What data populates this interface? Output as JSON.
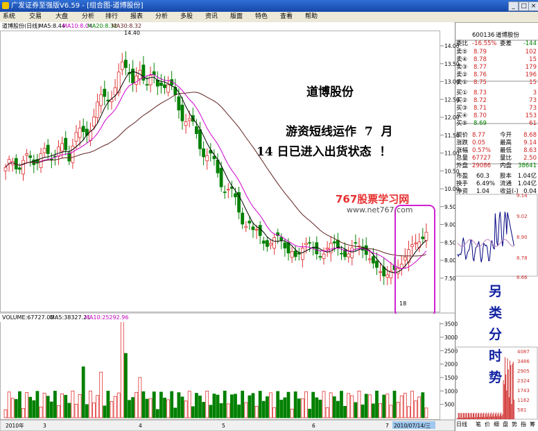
{
  "window": {
    "title": "广发证券至强版V6.59 - [组合图-道博股份]",
    "min": "_",
    "max": "□",
    "close": "×"
  },
  "menu": [
    "系统",
    "交易",
    "大盘",
    "分析",
    "排行",
    "报表",
    "分析",
    "多股",
    "资讯",
    "版面",
    "特色",
    "查看",
    "帮助"
  ],
  "chart_header": {
    "name": "道博股份(日线)",
    "ma5": "MA5:8.44",
    "ma10": "MA10:8.04",
    "ma20": "MA20:8.32",
    "ma30": "MA30:8.32"
  },
  "volume_header": {
    "vol": "VOLUME:67727.00",
    "ma5": "MA5:38327.21",
    "ma10": "MA10:25292.96"
  },
  "labels": {
    "high": "14.40",
    "low": "18",
    "watermark_cn": "767股票学习网",
    "watermark_url": "www.net767.com"
  },
  "annotations": {
    "stock": "道博股份",
    "line1": "游资短线运作  7  月",
    "line2": "14 日已进入出货状态  ！",
    "vertical": [
      "另",
      "类",
      "分",
      "时",
      "势"
    ]
  },
  "price_axis": [
    "14.00",
    "13.50",
    "13.00",
    "12.50",
    "12.00",
    "11.50",
    "11.00",
    "10.50",
    "10.00",
    "9.50",
    "9.00",
    "8.50",
    "8.00",
    "7.50"
  ],
  "volume_axis": [
    "3500",
    "3000",
    "2500",
    "2000",
    "1500",
    "1000",
    "500"
  ],
  "date_axis": [
    "2010年",
    "3",
    "4",
    "5",
    "6",
    "7",
    "2010/07/14/三"
  ],
  "quote": {
    "code": "600136",
    "name": "道博股份",
    "weibi_label": "委比",
    "weibi": "-16.55%",
    "weicha_label": "委差",
    "weicha": "-144",
    "asks": [
      {
        "label": "卖⑤",
        "price": "8.79",
        "vol": "102"
      },
      {
        "label": "卖④",
        "price": "8.78",
        "vol": "15"
      },
      {
        "label": "卖③",
        "price": "8.77",
        "vol": "179"
      },
      {
        "label": "卖②",
        "price": "8.76",
        "vol": "196"
      },
      {
        "label": "卖①",
        "price": "8.75",
        "vol": "15"
      }
    ],
    "bids": [
      {
        "label": "买①",
        "price": "8.73",
        "vol": "3"
      },
      {
        "label": "买②",
        "price": "8.72",
        "vol": "73"
      },
      {
        "label": "买③",
        "price": "8.71",
        "vol": "73"
      },
      {
        "label": "买④",
        "price": "8.70",
        "vol": "153"
      },
      {
        "label": "买⑤",
        "price": "8.69",
        "vol": "61"
      }
    ],
    "stats": [
      {
        "l1": "现价",
        "v1": "8.77",
        "l2": "今开",
        "v2": "8.68"
      },
      {
        "l1": "涨跌",
        "v1": "0.05",
        "l2": "最高",
        "v2": "9.14"
      },
      {
        "l1": "涨幅",
        "v1": "0.57%",
        "l2": "最低",
        "v2": "8.63"
      },
      {
        "l1": "总量",
        "v1": "67727",
        "l2": "量比",
        "v2": "2.50"
      },
      {
        "l1": "外盘",
        "v1": "29086",
        "l2": "内盘",
        "v2": "38641"
      }
    ],
    "fund": [
      {
        "l1": "市盈",
        "v1": "60.3",
        "l2": "股本",
        "v2": "1.04亿"
      },
      {
        "l1": "换手",
        "v1": "6.49%",
        "l2": "流通",
        "v2": "1.04亿"
      },
      {
        "l1": "净资",
        "v1": "1.04",
        "l2": "收益(-)",
        "v2": "0.04"
      }
    ]
  },
  "intraday_axis": [
    "9.14",
    "9.02",
    "8.90",
    "8.78",
    "8.66"
  ],
  "intraday_vol_axis": [
    "4087",
    "3486",
    "2905",
    "2324",
    "1743",
    "1162",
    "581"
  ],
  "bottom_tabs": [
    "日线",
    "笔",
    "价",
    "细",
    "盘",
    "势",
    "指",
    "筹"
  ],
  "colors": {
    "up": "#e03030",
    "down": "#008000",
    "ma5": "#000000",
    "ma10": "#d000d0",
    "ma30": "#602020",
    "highlight": "#d020d0"
  }
}
